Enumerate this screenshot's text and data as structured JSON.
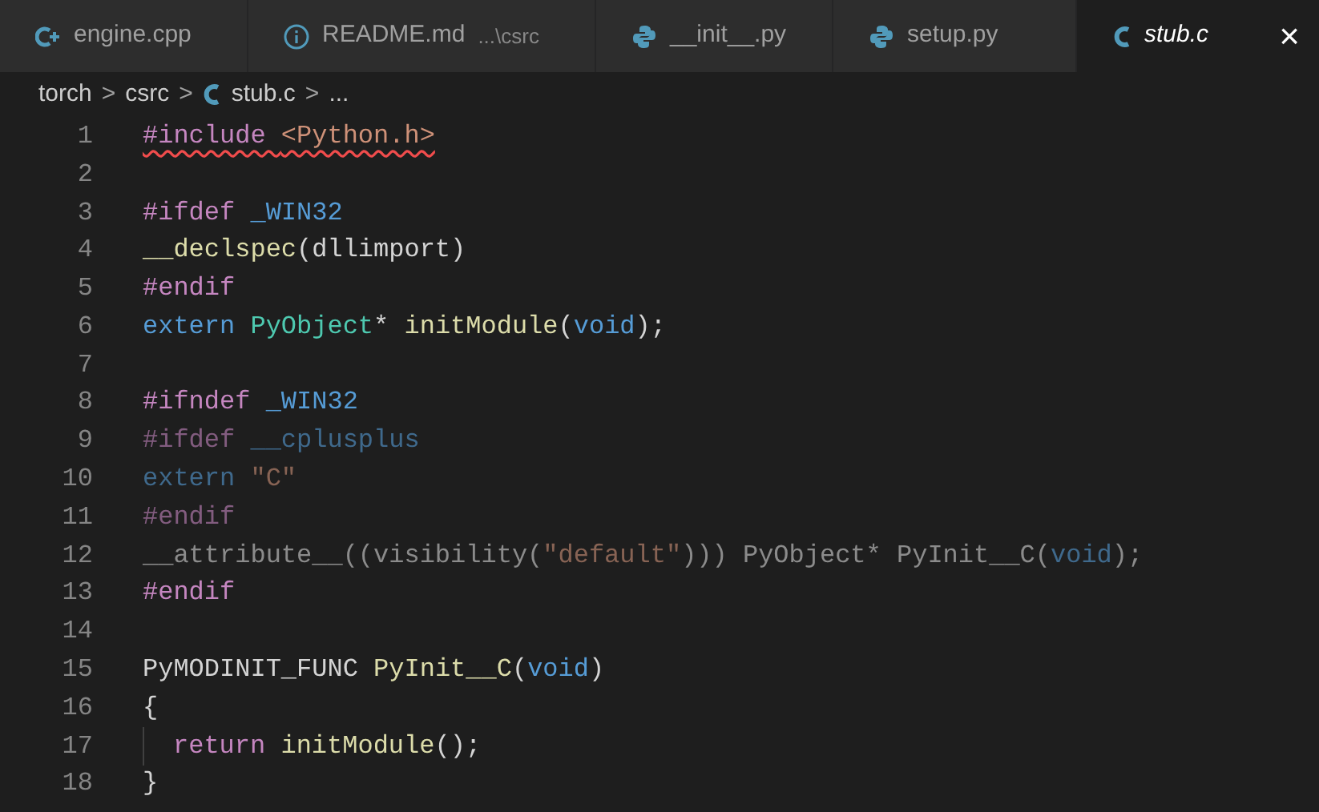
{
  "tabs": [
    {
      "label": "engine.cpp",
      "kind": "cpp",
      "selected": false
    },
    {
      "label": "README.md",
      "detail": "...\\csrc",
      "kind": "info",
      "selected": false
    },
    {
      "label": "__init__.py",
      "kind": "python",
      "selected": false
    },
    {
      "label": "setup.py",
      "kind": "python",
      "selected": false
    },
    {
      "label": "stub.c",
      "kind": "c",
      "selected": true,
      "close": "×"
    }
  ],
  "breadcrumbs": [
    {
      "label": "torch",
      "kind": "folder"
    },
    {
      "label": "csrc",
      "kind": "folder"
    },
    {
      "label": "stub.c",
      "kind": "c"
    },
    {
      "label": "...",
      "kind": "symbol"
    }
  ],
  "breadcrumb_separator": ">",
  "lines": [
    {
      "number": "1",
      "tokens": [
        {
          "text": "#include ",
          "kind": "keyword"
        },
        {
          "text": "<Python.h>",
          "kind": "string"
        }
      ],
      "error": true
    },
    {
      "number": "2"
    },
    {
      "number": "3",
      "tokens": [
        {
          "text": "#ifdef ",
          "kind": "keyword"
        },
        {
          "text": "_WIN32",
          "kind": "macro"
        }
      ]
    },
    {
      "number": "4",
      "tokens": [
        {
          "text": "__declspec",
          "kind": "func"
        },
        {
          "text": "(dllimport)",
          "kind": "plain"
        }
      ]
    },
    {
      "number": "5",
      "tokens": [
        {
          "text": "#endif",
          "kind": "keyword"
        }
      ]
    },
    {
      "number": "6",
      "tokens": [
        {
          "text": "extern ",
          "kind": "macro"
        },
        {
          "text": "PyObject",
          "kind": "type"
        },
        {
          "text": "* ",
          "kind": "plain"
        },
        {
          "text": "initModule",
          "kind": "func"
        },
        {
          "text": "(",
          "kind": "plain"
        },
        {
          "text": "void",
          "kind": "macro"
        },
        {
          "text": ");",
          "kind": "plain"
        }
      ]
    },
    {
      "number": "7"
    },
    {
      "number": "8",
      "tokens": [
        {
          "text": "#ifndef ",
          "kind": "keyword"
        },
        {
          "text": "_WIN32",
          "kind": "macro"
        }
      ]
    },
    {
      "number": "9",
      "dim": true,
      "tokens": [
        {
          "text": "#ifdef ",
          "kind": "keyword"
        },
        {
          "text": "__cplusplus",
          "kind": "macro"
        }
      ]
    },
    {
      "number": "10",
      "dim": true,
      "tokens": [
        {
          "text": "extern ",
          "kind": "macro"
        },
        {
          "text": "\"C\"",
          "kind": "string"
        }
      ]
    },
    {
      "number": "11",
      "dim": true,
      "tokens": [
        {
          "text": "#endif",
          "kind": "keyword"
        }
      ]
    },
    {
      "number": "12",
      "dim": true,
      "tokens": [
        {
          "text": "__attribute__((visibility(",
          "kind": "plain"
        },
        {
          "text": "\"default\"",
          "kind": "string"
        },
        {
          "text": "))) PyObject* PyInit__C(",
          "kind": "plain"
        },
        {
          "text": "void",
          "kind": "macro"
        },
        {
          "text": ");",
          "kind": "plain"
        }
      ]
    },
    {
      "number": "13",
      "tokens": [
        {
          "text": "#endif",
          "kind": "keyword"
        }
      ]
    },
    {
      "number": "14"
    },
    {
      "number": "15",
      "tokens": [
        {
          "text": "PyMODINIT_FUNC ",
          "kind": "plain"
        },
        {
          "text": "PyInit__C",
          "kind": "func"
        },
        {
          "text": "(",
          "kind": "plain"
        },
        {
          "text": "void",
          "kind": "macro"
        },
        {
          "text": ")",
          "kind": "plain"
        }
      ]
    },
    {
      "number": "16",
      "tokens": [
        {
          "text": "{",
          "kind": "plain"
        }
      ]
    },
    {
      "number": "17",
      "indent": true,
      "tokens": [
        {
          "text": "return ",
          "kind": "keyword"
        },
        {
          "text": "initModule",
          "kind": "func"
        },
        {
          "text": "();",
          "kind": "plain"
        }
      ]
    },
    {
      "number": "18",
      "tokens": [
        {
          "text": "}",
          "kind": "plain"
        }
      ]
    }
  ]
}
